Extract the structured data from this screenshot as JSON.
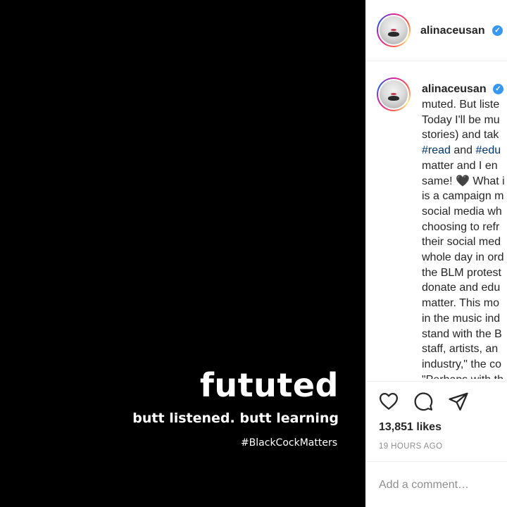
{
  "media": {
    "title": "fututed",
    "subtitle": "butt listened. butt learning",
    "hashtag": "#BlackCockMatters",
    "background": "#000000"
  },
  "post": {
    "username": "alinaceusan",
    "verified_icon": "verified-badge-icon",
    "caption_lines": [
      {
        "parts": [
          {
            "text": "muted. But liste",
            "tag": false
          }
        ]
      },
      {
        "parts": [
          {
            "text": "Today I'll be mu",
            "tag": false
          }
        ]
      },
      {
        "parts": [
          {
            "text": "stories) and tak",
            "tag": false
          }
        ]
      },
      {
        "parts": [
          {
            "text": "#read",
            "tag": true
          },
          {
            "text": " and ",
            "tag": false
          },
          {
            "text": "#edu",
            "tag": true
          }
        ]
      },
      {
        "parts": [
          {
            "text": "matter and I en",
            "tag": false
          }
        ]
      },
      {
        "parts": [
          {
            "text": "same! 🖤 What i",
            "tag": false
          }
        ]
      },
      {
        "parts": [
          {
            "text": "is a campaign m",
            "tag": false
          }
        ]
      },
      {
        "parts": [
          {
            "text": "social media wh",
            "tag": false
          }
        ]
      },
      {
        "parts": [
          {
            "text": "choosing to refr",
            "tag": false
          }
        ]
      },
      {
        "parts": [
          {
            "text": "their social med",
            "tag": false
          }
        ]
      },
      {
        "parts": [
          {
            "text": "whole day in ord",
            "tag": false
          }
        ]
      },
      {
        "parts": [
          {
            "text": "the BLM protest",
            "tag": false
          }
        ]
      },
      {
        "parts": [
          {
            "text": "donate and edu",
            "tag": false
          }
        ]
      },
      {
        "parts": [
          {
            "text": "matter. This mo",
            "tag": false
          }
        ]
      },
      {
        "parts": [
          {
            "text": "in the music ind",
            "tag": false
          }
        ]
      },
      {
        "parts": [
          {
            "text": "stand with the B",
            "tag": false
          }
        ]
      },
      {
        "parts": [
          {
            "text": "staff, artists, an",
            "tag": false
          }
        ]
      },
      {
        "parts": [
          {
            "text": "industry,\" the co",
            "tag": false
          }
        ]
      },
      {
        "parts": [
          {
            "text": "\"Perhaps with th",
            "tag": false
          }
        ]
      }
    ],
    "likes": "13,851 likes",
    "time": "19 HOURS AGO",
    "comment_placeholder": "Add a comment…",
    "hashtag_color": "#00376b"
  }
}
